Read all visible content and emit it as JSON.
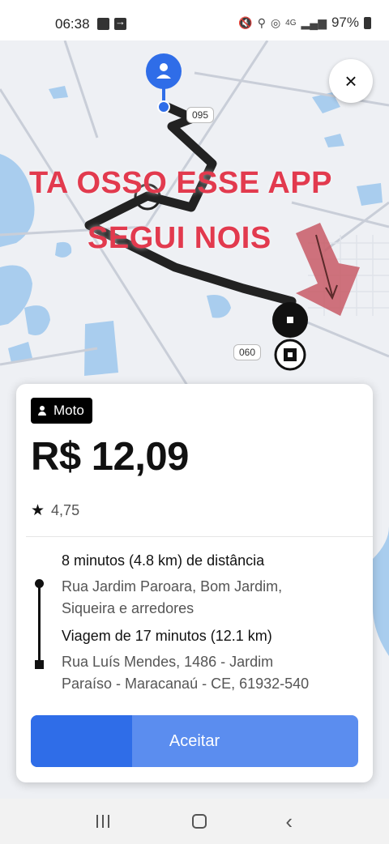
{
  "status_bar": {
    "time": "06:38",
    "network": "4G",
    "battery": "97%"
  },
  "map": {
    "overlay_text_line1": "TA OSSO ESSE APP",
    "overlay_text_line2": "SEGUI NOIS",
    "road_badge_1": "095",
    "road_badge_2": "060",
    "close_symbol": "×"
  },
  "offer": {
    "vehicle_type": "Moto",
    "price": "R$ 12,09",
    "rating": "4,75",
    "pickup_eta": "8 minutos (4.8 km) de distância",
    "pickup_address": [
      "Rua Jardim Paroara, Bom Jardim,",
      "Siqueira e arredores"
    ],
    "trip_duration": "Viagem de 17 minutos (12.1 km)",
    "dropoff_address": [
      "Rua Luís Mendes, 1486 - Jardim",
      "Paraíso - Maracanaú - CE, 61932-540"
    ],
    "accept_label": "Aceitar",
    "accept_progress_percent": 31
  },
  "colors": {
    "accent": "#2f6de8",
    "accent_light": "#5b8def",
    "overlay_text": "#e23a4e",
    "route_line": "#222222",
    "water": "#a9cdee"
  }
}
